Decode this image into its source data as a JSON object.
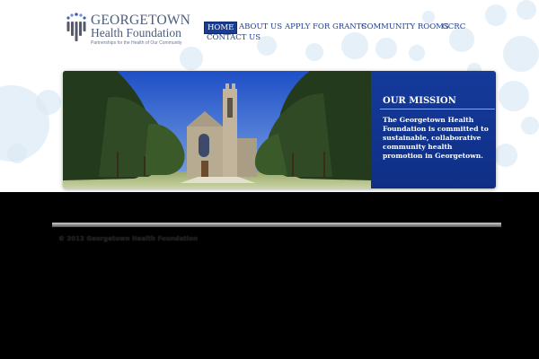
{
  "logo": {
    "title": "GEORGETOWN",
    "subtitle": "Health Foundation",
    "tagline": "Partnerships for the Health of Our Community"
  },
  "nav": {
    "items": [
      {
        "label": "HOME",
        "active": true
      },
      {
        "label": "ABOUT US",
        "active": false
      },
      {
        "label": "APPLY FOR GRANTS",
        "active": false
      },
      {
        "label": "COMMUNITY ROOMS",
        "active": false
      },
      {
        "label": "GCRC",
        "active": false
      },
      {
        "label": "CONTACT US",
        "active": false
      }
    ]
  },
  "mission": {
    "title": "OUR MISSION",
    "text": "The Georgetown Health Foundation is committed to sustainable, collaborative community health promotion in Georgetown."
  },
  "footer": {
    "copyright": "© 2012 Georgetown Health Foundation"
  },
  "colors": {
    "brand_blue": "#1a3d94",
    "nav_text": "#1d3f8f",
    "mission_bg": "#143a9a",
    "page_bg": "#000000"
  }
}
